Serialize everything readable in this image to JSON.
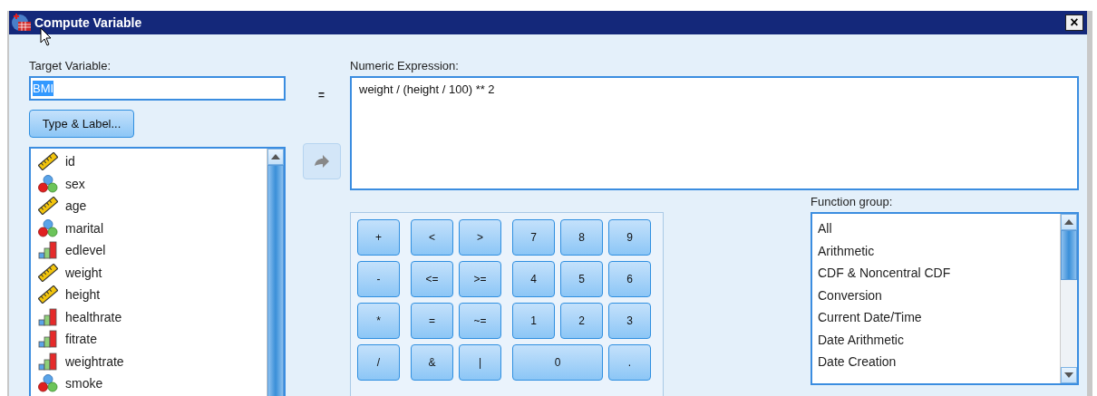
{
  "window": {
    "title": "Compute Variable",
    "close": "×"
  },
  "target": {
    "label": "Target Variable:",
    "value": "BMI",
    "selected": true
  },
  "equals": "=",
  "type_label_button": "Type & Label...",
  "variables": [
    {
      "name": "id",
      "kind": "scale"
    },
    {
      "name": "sex",
      "kind": "nominal"
    },
    {
      "name": "age",
      "kind": "scale"
    },
    {
      "name": "marital",
      "kind": "nominal"
    },
    {
      "name": "edlevel",
      "kind": "ordinal"
    },
    {
      "name": "weight",
      "kind": "scale"
    },
    {
      "name": "height",
      "kind": "scale"
    },
    {
      "name": "healthrate",
      "kind": "ordinal"
    },
    {
      "name": "fitrate",
      "kind": "ordinal"
    },
    {
      "name": "weightrate",
      "kind": "ordinal"
    },
    {
      "name": "smoke",
      "kind": "nominal"
    }
  ],
  "expression": {
    "label": "Numeric Expression:",
    "value": "weight / (height / 100) ** 2"
  },
  "keypad": [
    {
      "keys": [
        {
          "label": "+",
          "kind": "normal"
        },
        {
          "label": "-",
          "kind": "normal"
        },
        {
          "label": "*",
          "kind": "normal"
        },
        {
          "label": "/",
          "kind": "normal"
        }
      ]
    },
    {
      "keys": [
        {
          "label": "<",
          "kind": "normal"
        },
        {
          "label": ">",
          "kind": "normal"
        },
        {
          "label": "<=",
          "kind": "normal"
        },
        {
          "label": ">=",
          "kind": "normal"
        },
        {
          "label": "=",
          "kind": "normal"
        },
        {
          "label": "~=",
          "kind": "normal"
        },
        {
          "label": "&",
          "kind": "normal"
        },
        {
          "label": "|",
          "kind": "normal"
        }
      ]
    },
    {
      "keys": [
        {
          "label": "7",
          "kind": "normal"
        },
        {
          "label": "8",
          "kind": "normal"
        },
        {
          "label": "9",
          "kind": "normal"
        },
        {
          "label": "4",
          "kind": "normal"
        },
        {
          "label": "5",
          "kind": "normal"
        },
        {
          "label": "6",
          "kind": "normal"
        },
        {
          "label": "1",
          "kind": "normal"
        },
        {
          "label": "2",
          "kind": "normal"
        },
        {
          "label": "3",
          "kind": "normal"
        },
        {
          "label": "0",
          "kind": "wide"
        },
        {
          "label": ".",
          "kind": "normal"
        }
      ]
    }
  ],
  "function_group": {
    "label": "Function group:",
    "items": [
      "All",
      "Arithmetic",
      "CDF & Noncentral CDF",
      "Conversion",
      "Current Date/Time",
      "Date Arithmetic",
      "Date Creation"
    ]
  }
}
